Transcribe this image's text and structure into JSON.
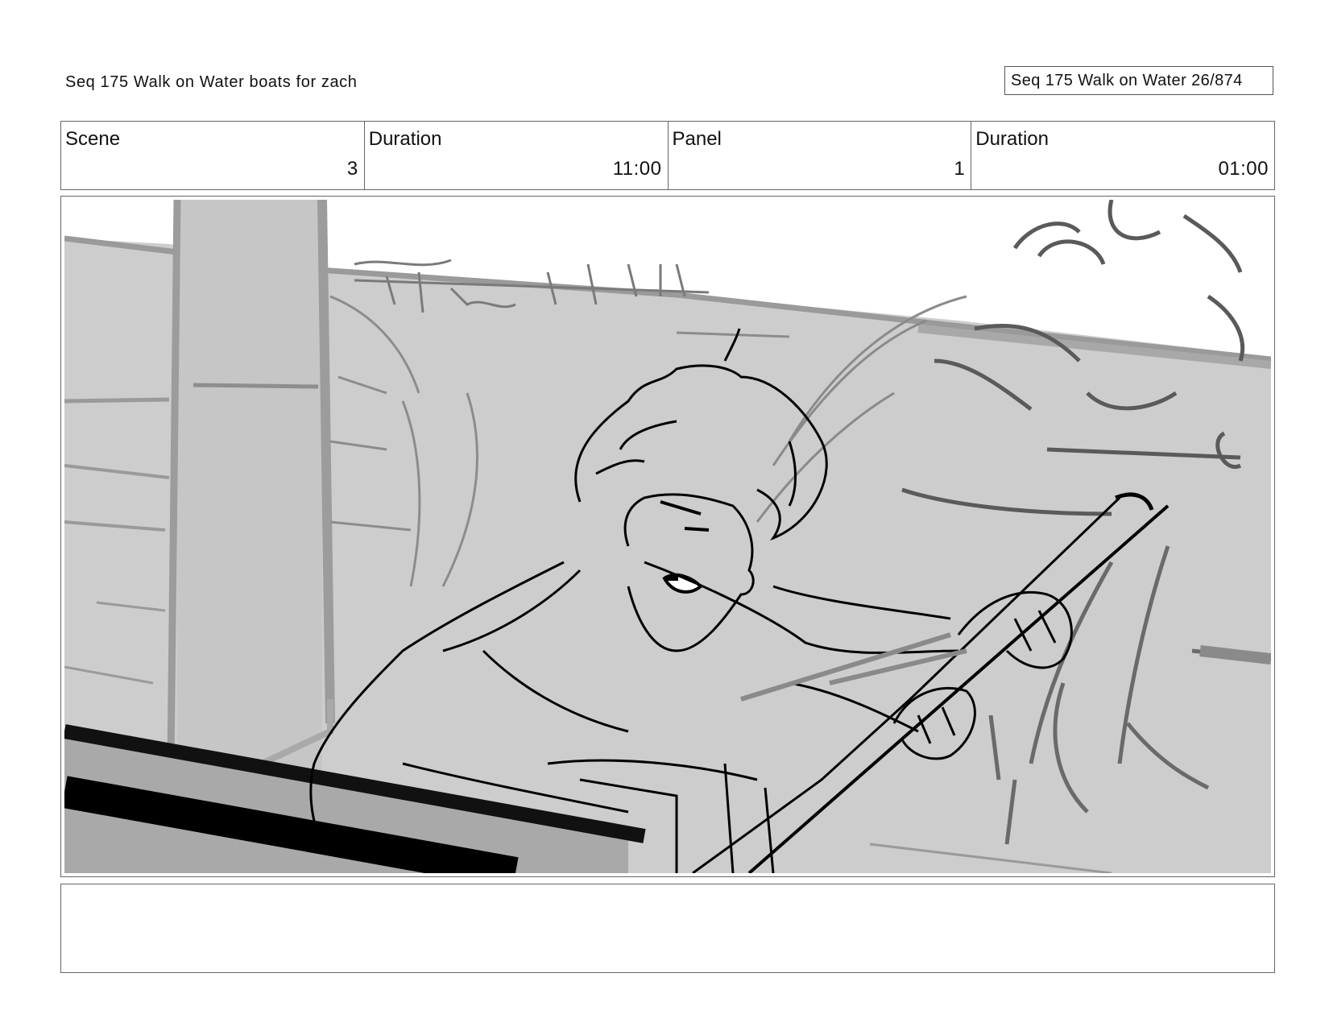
{
  "header": {
    "left_title": "Seq 175 Walk on Water  boats for zach",
    "right_title": "Seq 175 Walk on Water  26/874"
  },
  "info": {
    "scene_label": "Scene",
    "scene_value": "3",
    "scene_duration_label": "Duration",
    "scene_duration_value": "11:00",
    "panel_label": "Panel",
    "panel_value": "1",
    "panel_duration_label": "Duration",
    "panel_duration_value": "01:00"
  },
  "notes": {
    "text": ""
  }
}
